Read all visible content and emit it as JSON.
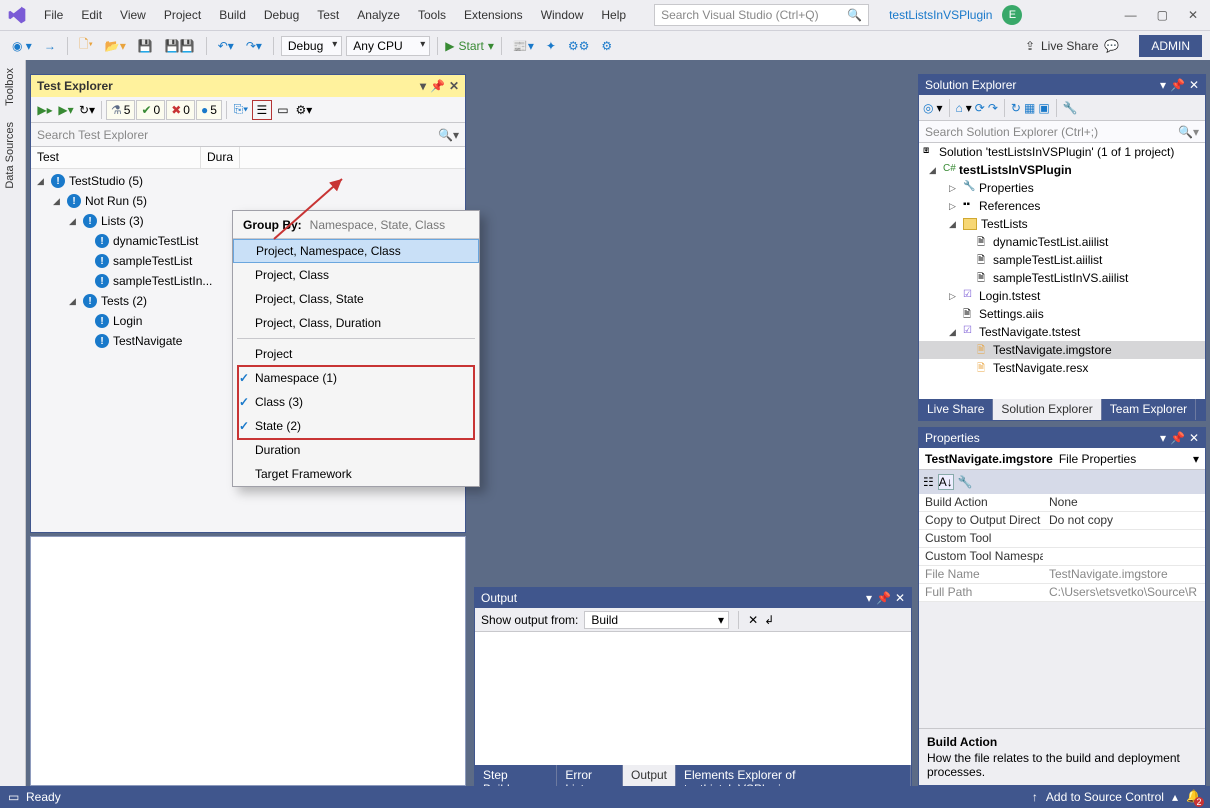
{
  "titlebar": {
    "menus": [
      "File",
      "Edit",
      "View",
      "Project",
      "Build",
      "Debug",
      "Test",
      "Analyze",
      "Tools",
      "Extensions",
      "Window",
      "Help"
    ],
    "search_placeholder": "Search Visual Studio (Ctrl+Q)",
    "project": "testListsInVSPlugin",
    "avatar": "E"
  },
  "toolbar": {
    "config": "Debug",
    "platform": "Any CPU",
    "start": "Start",
    "live_share": "Live Share",
    "admin": "ADMIN"
  },
  "sidebar": {
    "toolbox": "Toolbox",
    "datasources": "Data Sources"
  },
  "test_explorer": {
    "title": "Test Explorer",
    "search": "Search Test Explorer",
    "badges": {
      "flask": "5",
      "pass": "0",
      "fail": "0",
      "info": "5"
    },
    "cols": {
      "test": "Test",
      "duration": "Dura"
    },
    "tree": {
      "root": "TestStudio  (5)",
      "notrun": "Not Run  (5)",
      "lists": "Lists  (3)",
      "l1": "dynamicTestList",
      "l2": "sampleTestList",
      "l3": "sampleTestListIn...",
      "tests": "Tests  (2)",
      "t1": "Login",
      "t2": "TestNavigate"
    }
  },
  "groupby": {
    "label": "Group By:",
    "current": "Namespace, State, Class",
    "i1": "Project, Namespace, Class",
    "i2": "Project, Class",
    "i3": "Project, Class, State",
    "i4": "Project, Class, Duration",
    "i5": "Project",
    "i6": "Namespace (1)",
    "i7": "Class (3)",
    "i8": "State (2)",
    "i9": "Duration",
    "i10": "Target Framework"
  },
  "output": {
    "title": "Output",
    "show_label": "Show output from:",
    "show_value": "Build",
    "tabs": [
      "Step Builder",
      "Error List",
      "Output",
      "Elements Explorer of testListsInVSPlugin"
    ]
  },
  "solution": {
    "title": "Solution Explorer",
    "search": "Search Solution Explorer (Ctrl+;)",
    "root": "Solution 'testListsInVSPlugin' (1 of 1 project)",
    "proj": "testListsInVSPlugin",
    "props": "Properties",
    "refs": "References",
    "fold": "TestLists",
    "f1": "dynamicTestList.aiilist",
    "f2": "sampleTestList.aiilist",
    "f3": "sampleTestListInVS.aiilist",
    "login": "Login.tstest",
    "settings": "Settings.aiis",
    "nav": "TestNavigate.tstest",
    "nav1": "TestNavigate.imgstore",
    "nav2": "TestNavigate.resx",
    "tabs": [
      "Live Share",
      "Solution Explorer",
      "Team Explorer"
    ]
  },
  "properties": {
    "title": "Properties",
    "obj": "TestNavigate.imgstore",
    "obj_type": "File Properties",
    "rows": [
      {
        "k": "Build Action",
        "v": "None"
      },
      {
        "k": "Copy to Output Direct",
        "v": "Do not copy"
      },
      {
        "k": "Custom Tool",
        "v": ""
      },
      {
        "k": "Custom Tool Namespa",
        "v": ""
      },
      {
        "k": "File Name",
        "v": "TestNavigate.imgstore",
        "gray": true
      },
      {
        "k": "Full Path",
        "v": "C:\\Users\\etsvetko\\Source\\R",
        "gray": true
      }
    ],
    "desc_title": "Build Action",
    "desc": "How the file relates to the build and deployment processes."
  },
  "status": {
    "ready": "Ready",
    "source": "Add to Source Control",
    "notif": "2"
  }
}
